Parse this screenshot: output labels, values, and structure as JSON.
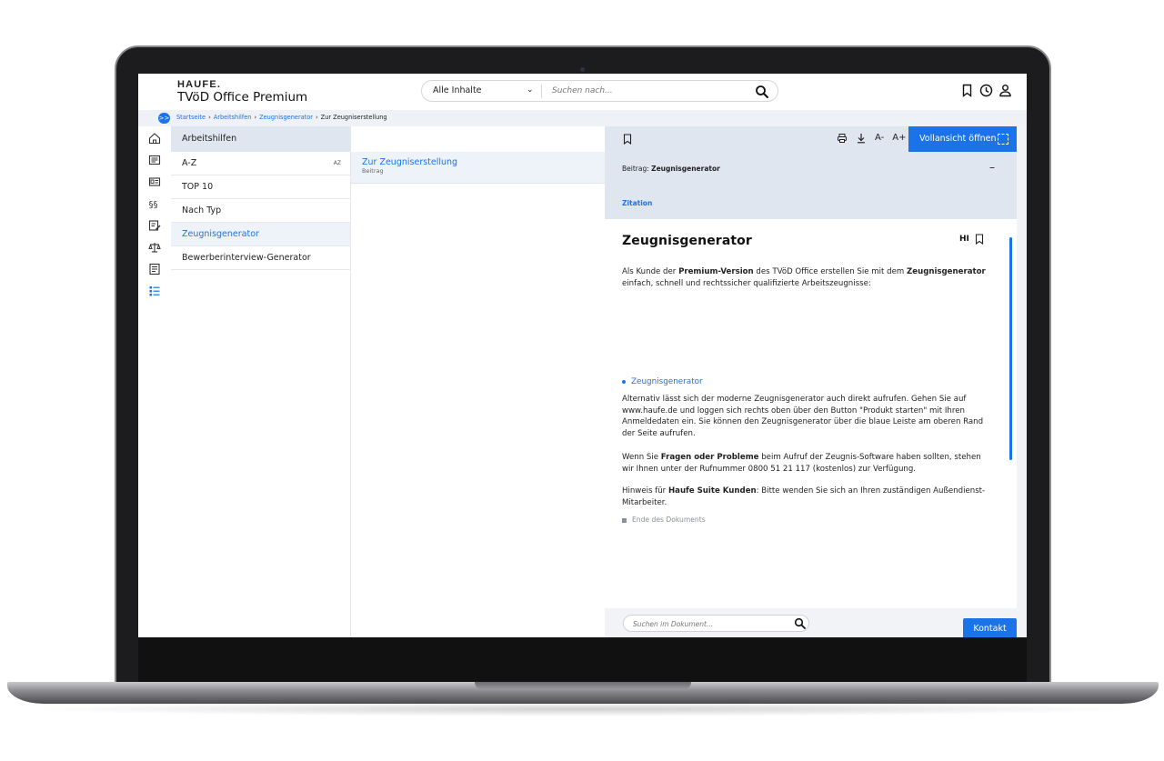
{
  "app": {
    "logo": "HAUFE.",
    "product": "TVöD Office Premium"
  },
  "search": {
    "scope": "Alle Inhalte",
    "placeholder": "Suchen nach..."
  },
  "breadcrumb": {
    "toggle": ">>",
    "items": [
      "Startseite",
      "Arbeitshilfen",
      "Zeugnisgenerator"
    ],
    "current": "Zur Zeugniserstellung"
  },
  "col1": {
    "header": "Arbeitshilfen",
    "items": [
      {
        "label": "A-Z",
        "badge": "AZ"
      },
      {
        "label": "TOP 10"
      },
      {
        "label": "Nach Typ"
      },
      {
        "label": "Zeugnisgenerator"
      },
      {
        "label": "Bewerberinterview-Generator"
      }
    ]
  },
  "col2": {
    "items": [
      {
        "title": "Zur Zeugniserstellung",
        "subtitle": "Beitrag"
      }
    ]
  },
  "doc": {
    "toolbar": {
      "font_smaller": "A-",
      "font_larger": "A+",
      "full_view": "Vollansicht öffnen"
    },
    "meta_prefix": "Beitrag:",
    "meta_title": "Zeugnisgenerator",
    "collapse": "–",
    "zitation": "Zitation",
    "title": "Zeugnisgenerator",
    "hl": "HI",
    "p1": {
      "a": "Als Kunde der ",
      "b": "Premium-Version",
      "c": " des TVöD Office erstellen Sie mit dem ",
      "d": "Zeugnisgenerator",
      "e": " einfach, schnell und rechtssicher qualifizierte Arbeitszeugnisse:"
    },
    "bullet": "Zeugnisgenerator",
    "p2": "Alternativ lässt sich der moderne Zeugnisgenerator auch direkt aufrufen. Gehen Sie auf www.haufe.de und loggen sich rechts oben über den Button \"Produkt starten\" mit Ihren Anmeldedaten ein. Sie können den Zeugnisgenerator über die blaue Leiste am oberen Rand der Seite aufrufen.",
    "p3": {
      "a": "Wenn Sie ",
      "b": "Fragen oder Probleme",
      "c": " beim Aufruf der Zeugnis-Software haben sollten, stehen wir Ihnen unter der Rufnummer 0800 51 21 117 (kostenlos) zur Verfügung."
    },
    "p4": {
      "a": "Hinweis für ",
      "b": "Haufe Suite Kunden",
      "c": ": Bitte wenden Sie sich an Ihren zuständigen Außendienst-Mitarbeiter."
    },
    "end": "Ende des Dokuments",
    "search_placeholder": "Suchen im Dokument...",
    "contact": "Kontakt"
  },
  "colors": {
    "accent": "#1a73e8",
    "panel": "#dfe6f0",
    "active_bg": "#eef3f9"
  },
  "icons": {
    "header": [
      "bookmark-icon",
      "history-icon",
      "user-icon"
    ],
    "rail": [
      "home-icon",
      "news-icon",
      "id-card-icon",
      "paragraph-icon",
      "edit-doc-icon",
      "scales-icon",
      "document-icon",
      "list-icon"
    ]
  }
}
